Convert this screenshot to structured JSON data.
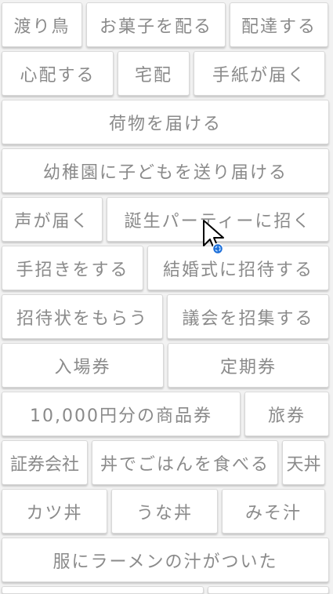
{
  "rows": [
    [
      "渡り鳥",
      "お菓子を配る",
      "配達する"
    ],
    [
      "心配する",
      "宅配",
      "手紙が届く"
    ],
    [
      "荷物を届ける"
    ],
    [
      "幼稚園に子どもを送り届ける"
    ],
    [
      "声が届く",
      "誕生パーティーに招く"
    ],
    [
      "手招きをする",
      "結婚式に招待する"
    ],
    [
      "招待状をもらう",
      "議会を招集する"
    ],
    [
      "入場券",
      "定期券"
    ],
    [
      "10,000円分の商品券",
      "旅券"
    ],
    [
      "証券会社",
      "丼でごはんを食べる",
      "天丼"
    ],
    [
      "カツ丼",
      "うな丼",
      "みそ汁"
    ],
    [
      "服にラーメンの汁がついた"
    ]
  ],
  "cursor_icon": "arrow-pointer-with-loading-icon"
}
